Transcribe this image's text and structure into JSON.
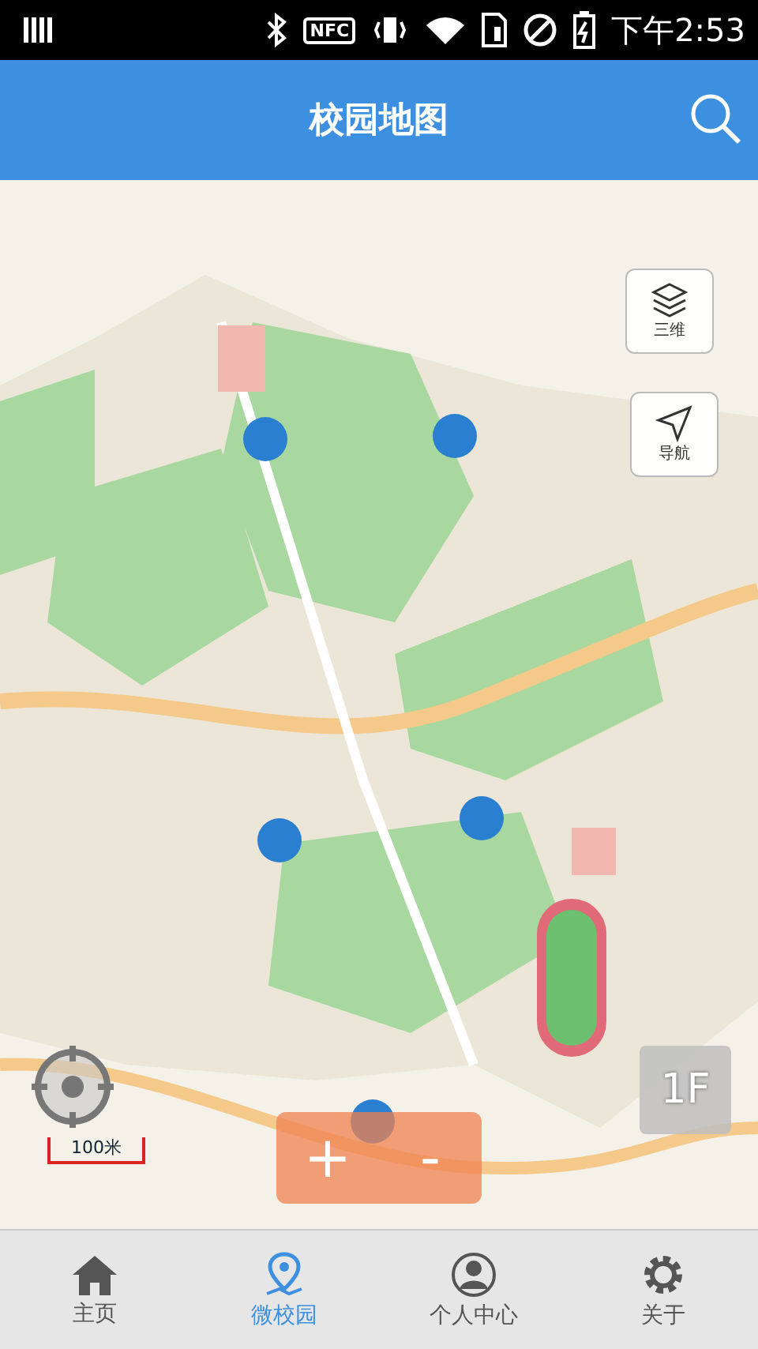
{
  "status_bar": {
    "nfc": "NFC",
    "time": "下午2:53"
  },
  "header": {
    "title": "校园地图"
  },
  "map": {
    "layers_label": "三维",
    "navigate_label": "导航",
    "scale": "100米",
    "floor": "1F",
    "zoom_in": "+",
    "zoom_out": "-"
  },
  "nav": [
    {
      "kind": "home",
      "label": "主页",
      "selected": false
    },
    {
      "kind": "pin",
      "label": "微校园",
      "selected": true
    },
    {
      "kind": "person",
      "label": "个人中心",
      "selected": false
    },
    {
      "kind": "gear",
      "label": "关于",
      "selected": false
    }
  ]
}
